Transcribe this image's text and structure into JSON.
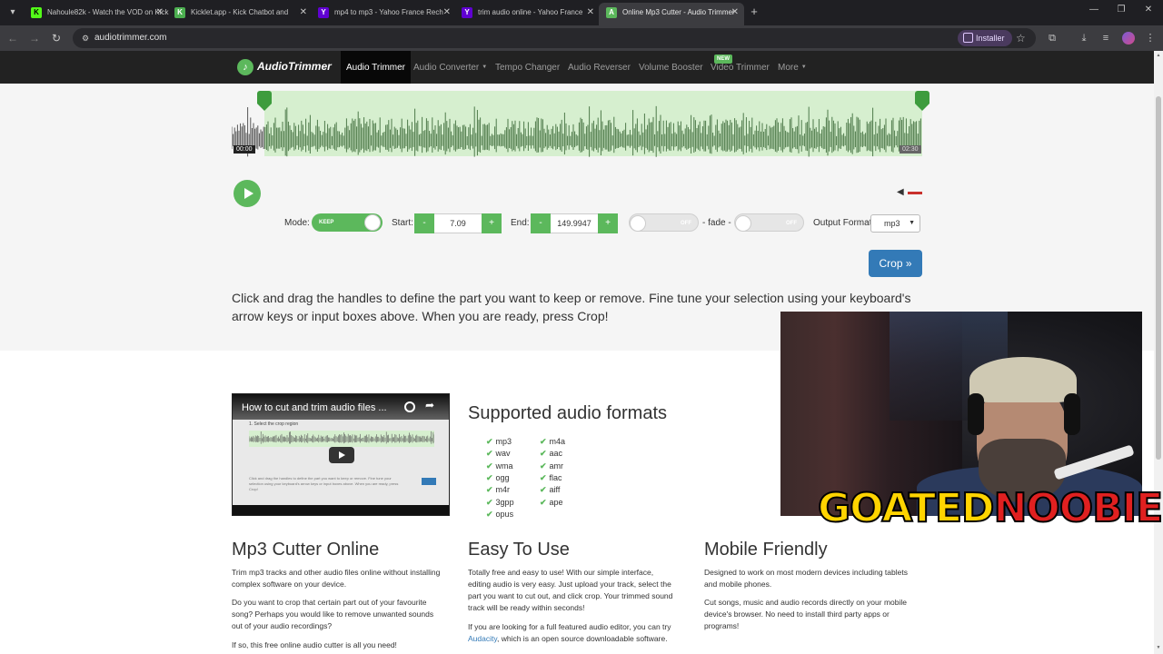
{
  "browser": {
    "tabs": [
      {
        "title": "Nahoule82k - Watch the VOD on Kick",
        "favicon": "K",
        "color": "#53fc18",
        "active": false
      },
      {
        "title": "Kicklet.app - Kick Chatbot and",
        "favicon": "K",
        "color": "#4caf50",
        "active": false
      },
      {
        "title": "mp4 to mp3 - Yahoo France Rech",
        "favicon": "Y",
        "color": "#6001d2",
        "active": false
      },
      {
        "title": "trim audio online - Yahoo France",
        "favicon": "Y",
        "color": "#6001d2",
        "active": false
      },
      {
        "title": "Online Mp3 Cutter - Audio Trimmer",
        "favicon": "A",
        "color": "#5cb85c",
        "active": true
      }
    ],
    "url": "audiotrimmer.com",
    "install_label": "Installer"
  },
  "site_nav": {
    "logo": "AudioTrimmer",
    "items": [
      {
        "label": "Audio Trimmer",
        "active": true
      },
      {
        "label": "Audio Converter",
        "dropdown": true
      },
      {
        "label": "Tempo Changer"
      },
      {
        "label": "Audio Reverser"
      },
      {
        "label": "Volume Booster"
      },
      {
        "label": "Video Trimmer",
        "badge": "NEW"
      },
      {
        "label": "More",
        "dropdown": true
      }
    ]
  },
  "editor": {
    "time_start": "00:00",
    "time_end": "02:30",
    "mode_label": "Mode:",
    "mode_toggle": "KEEP",
    "start_label": "Start:",
    "start_value": "7.09",
    "end_label": "End:",
    "end_value": "149.9947",
    "fade_in_toggle": "OFF",
    "fade_label": "- fade -",
    "fade_out_toggle": "OFF",
    "output_format_label": "Output Format",
    "output_format_value": "mp3",
    "minus": "-",
    "plus": "+",
    "crop_button": "Crop »",
    "instructions": "Click and drag the handles to define the part you want to keep or remove. Fine tune your selection using your keyboard's arrow keys or input boxes above. When you are ready, press Crop!",
    "selection_start_fraction": 0.047,
    "selection_end_fraction": 1.0
  },
  "video": {
    "title": "How to cut and trim audio files ...",
    "inner_caption": "1. Select the crop region"
  },
  "formats": {
    "title": "Supported audio formats",
    "col1": [
      "mp3",
      "wav",
      "wma",
      "ogg",
      "m4r",
      "3gpp",
      "opus"
    ],
    "col2": [
      "m4a",
      "aac",
      "amr",
      "flac",
      "aiff",
      "ape"
    ]
  },
  "columns": [
    {
      "title": "Mp3 Cutter Online",
      "paragraphs": [
        "Trim mp3 tracks and other audio files online without installing complex software on your device.",
        "Do you want to crop that certain part out of your favourite song? Perhaps you would like to remove unwanted sounds out of your audio recordings?",
        "If so, this free online audio cutter is all you need!"
      ]
    },
    {
      "title": "Easy To Use",
      "paragraphs": [
        "Totally free and easy to use! With our simple interface, editing audio is very easy. Just upload your track, select the part you want to cut out, and click crop. Your trimmed sound track will be ready within seconds!"
      ],
      "p2_before": "If you are looking for a full featured audio editor, you can try ",
      "p2_link": "Audacity",
      "p2_after": ", which is an open source downloadable software."
    },
    {
      "title": "Mobile Friendly",
      "paragraphs": [
        "Designed to work on most modern devices including tablets and mobile phones.",
        "Cut songs, music and audio records directly on your mobile device's browser. No need to install third party apps or programs!"
      ]
    }
  ],
  "webcam": {
    "banner_part1": "GOATED",
    "banner_part2": "NOOBIE"
  },
  "colors": {
    "brand_green": "#5cb85c",
    "crop_blue": "#337ab7",
    "nav_dark": "#222222"
  }
}
